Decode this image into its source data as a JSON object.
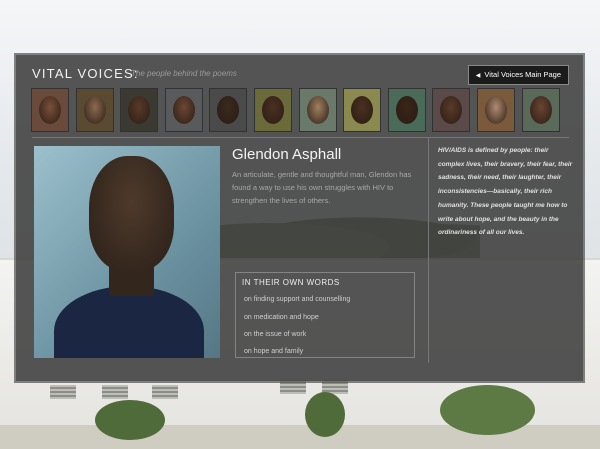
{
  "header": {
    "title": "VITAL VOICES:",
    "subtitle": "The people behind the poems",
    "main_page_button": "Vital Voices Main Page"
  },
  "thumbnails": [
    {
      "label": "portrait-1",
      "bg": "#6a4a3a",
      "face": "#7a503a"
    },
    {
      "label": "portrait-2",
      "bg": "#5b4a32",
      "face": "#8a6a50"
    },
    {
      "label": "portrait-3",
      "bg": "#3b3a32",
      "face": "#5a3a28"
    },
    {
      "label": "portrait-4",
      "bg": "#585a5c",
      "face": "#6b4634"
    },
    {
      "label": "portrait-5",
      "bg": "#4a4a4a",
      "face": "#3a2a20"
    },
    {
      "label": "portrait-6",
      "bg": "#6b6a3a",
      "face": "#4a3022"
    },
    {
      "label": "portrait-7",
      "bg": "#6a7a6a",
      "face": "#a08060"
    },
    {
      "label": "portrait-8",
      "bg": "#8a8a50",
      "face": "#4a3020"
    },
    {
      "label": "portrait-9",
      "bg": "#4a6a5a",
      "face": "#3a2518"
    },
    {
      "label": "portrait-10",
      "bg": "#5a4a4a",
      "face": "#5a3a2a"
    },
    {
      "label": "portrait-11",
      "bg": "#7a5a3a",
      "face": "#b08a70"
    },
    {
      "label": "portrait-12",
      "bg": "#5a6a5a",
      "face": "#6a4432"
    }
  ],
  "profile": {
    "name": "Glendon Asphall",
    "bio": "An articulate, gentle and thoughtful man, Glendon has found a way to use his own struggles with HIV to strengthen the lives of others."
  },
  "own_words": {
    "title": "IN THEIR OWN WORDS",
    "links": [
      "on finding support and counselling",
      "on medication and hope",
      "on the issue of work",
      "on hope and family"
    ]
  },
  "quote": "HIV/AIDS is defined by people: their complex lives, their bravery, their fear, their sadness, their need, their laughter, their inconsistencies—basically, their rich humanity. These people taught me how to write about hope, and the beauty in the ordinariness of all our lives.",
  "colors": {
    "panel_bg": "#3a3a3a",
    "accent_text": "#f2f2f2",
    "muted_text": "#a8a8a8"
  }
}
